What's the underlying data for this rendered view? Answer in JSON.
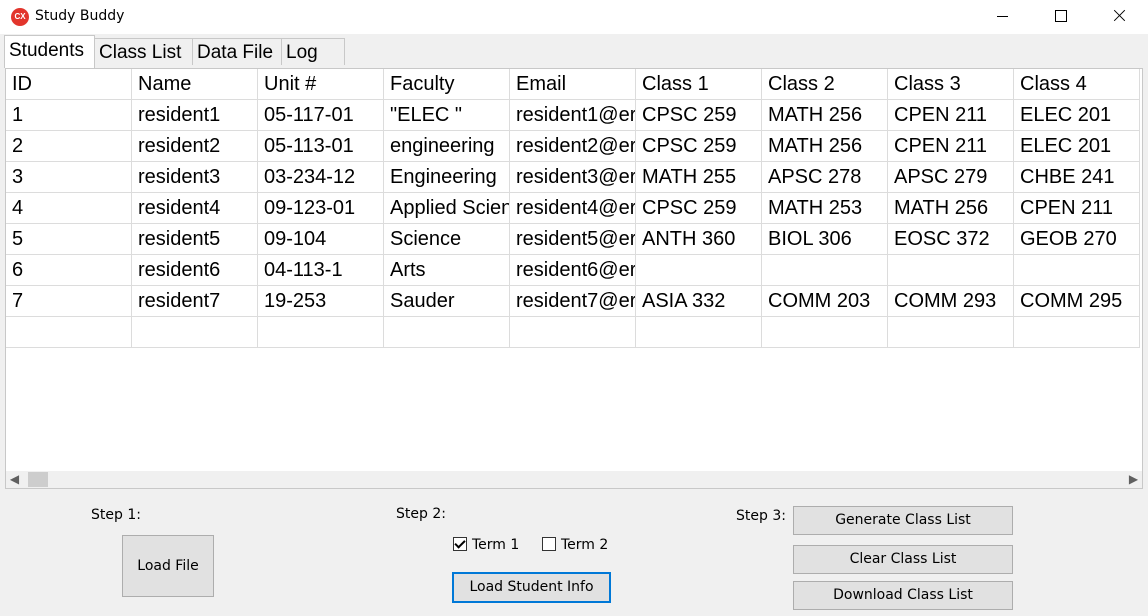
{
  "window": {
    "title": "Study Buddy",
    "icon_text": "CX"
  },
  "tabs": [
    {
      "label": "Students",
      "active": true
    },
    {
      "label": "Class List",
      "active": false
    },
    {
      "label": "Data File",
      "active": false
    },
    {
      "label": "Log",
      "active": false
    }
  ],
  "table": {
    "columns": [
      "ID",
      "Name",
      "Unit #",
      "Faculty",
      "Email",
      "Class 1",
      "Class 2",
      "Class 3",
      "Class 4"
    ],
    "rows": [
      [
        "1",
        "resident1",
        "05-117-01",
        "\"ELEC \"",
        "resident1@er",
        "CPSC 259",
        "MATH 256",
        "CPEN 211",
        "ELEC 201"
      ],
      [
        "2",
        " resident2",
        "05-113-01",
        "engineering",
        "resident2@er",
        "CPSC 259",
        "MATH 256",
        "CPEN 211",
        "ELEC 201"
      ],
      [
        "3",
        " resident3",
        "03-234-12",
        "Engineering",
        "resident3@er",
        "MATH 255",
        "APSC 278",
        "APSC 279",
        "CHBE 241"
      ],
      [
        "4",
        " resident4",
        "09-123-01",
        "Applied Scien",
        "resident4@er",
        "CPSC 259",
        "MATH 253",
        "MATH 256",
        "CPEN 211"
      ],
      [
        "5",
        " resident5",
        "09-104",
        "Science",
        "resident5@er",
        "ANTH 360",
        "BIOL 306",
        "EOSC 372",
        "GEOB 270"
      ],
      [
        "6",
        " resident6",
        "04-113-1",
        "Arts",
        "resident6@er",
        "",
        "",
        "",
        ""
      ],
      [
        "7",
        " resident7",
        "19-253",
        "Sauder",
        "resident7@er",
        "ASIA 332",
        "COMM 203",
        "COMM 293",
        "COMM 295"
      ],
      [
        "",
        "",
        "",
        "",
        "",
        "",
        "",
        "",
        ""
      ]
    ]
  },
  "step1": {
    "label": "Step 1:",
    "load_file": "Load File"
  },
  "step2": {
    "label": "Step 2:",
    "term1": {
      "label": "Term 1",
      "checked": true
    },
    "term2": {
      "label": "Term 2",
      "checked": false
    },
    "load_student_info": "Load Student Info"
  },
  "step3": {
    "label": "Step 3:",
    "generate": "Generate Class List",
    "clear": "Clear Class List",
    "download": "Download Class List"
  },
  "icons": {
    "scroll_left": "◀",
    "scroll_right": "▶"
  }
}
